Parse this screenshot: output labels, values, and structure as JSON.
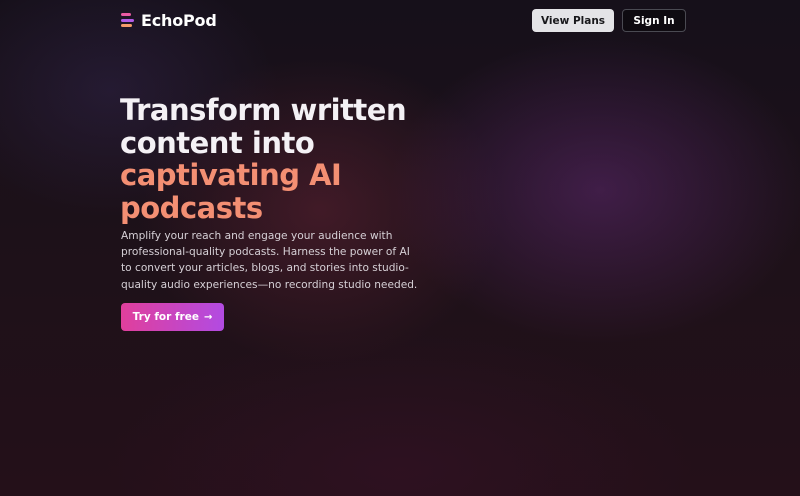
{
  "brand": {
    "name": "EchoPod",
    "logo_colors": [
      "#e95aa3",
      "#b25be6",
      "#f59b6b"
    ]
  },
  "header": {
    "view_plans_label": "View Plans",
    "sign_in_label": "Sign In"
  },
  "hero": {
    "headline_lines": [
      "Transform written",
      "content into",
      "captivating AI",
      "podcasts"
    ],
    "description_lines": [
      "Amplify your reach and engage your audience with",
      "professional-quality podcasts. Harness the power of AI",
      "to convert your articles, blogs, and stories into studio-",
      "quality audio experiences—no recording studio needed."
    ],
    "cta_label": "Try for free",
    "cta_icon": "arrow-right-icon",
    "cta_arrow": "→"
  },
  "colors": {
    "background": "#1b1117",
    "accent_text": "#f38f73",
    "cta_gradient_start": "#e03f9c",
    "cta_gradient_end": "#b24be2"
  }
}
